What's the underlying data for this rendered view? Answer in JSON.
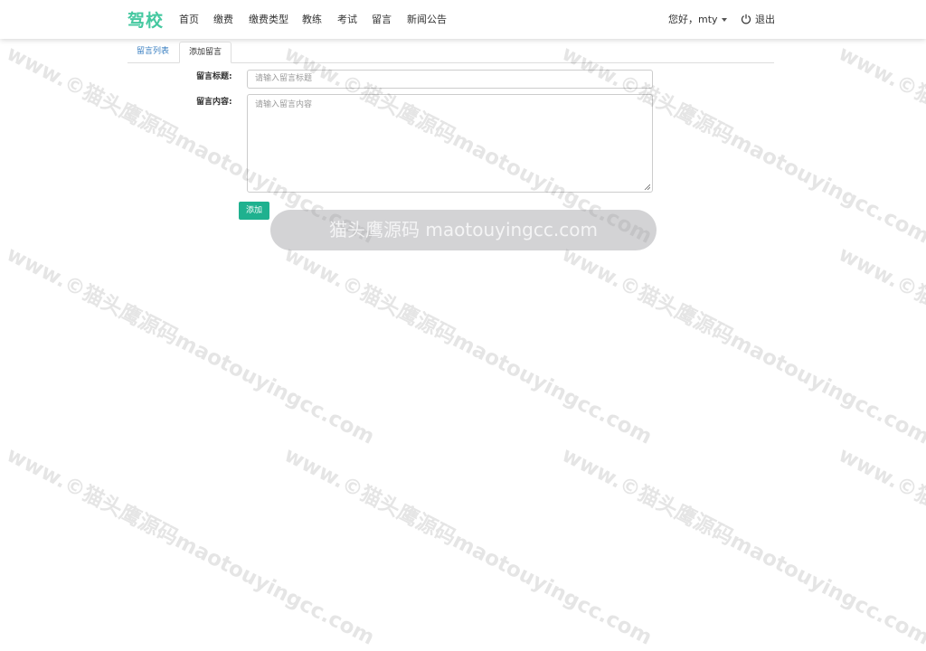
{
  "navbar": {
    "brand": "驾校",
    "items": [
      "首页",
      "缴费",
      "缴费类型",
      "教练",
      "考试",
      "留言",
      "新闻公告"
    ],
    "user_greeting": "您好，mty",
    "logout_label": "退出"
  },
  "tabs": {
    "list_label": "留言列表",
    "add_label": "添加留言"
  },
  "form": {
    "title_label": "留言标题:",
    "title_placeholder": "请输入留言标题",
    "content_label": "留言内容:",
    "content_placeholder": "请输入留言内容",
    "submit_label": "添加"
  },
  "watermark": {
    "text": "www.©猫头鹰源码maotouyingcc.com",
    "banner": "猫头鹰源码 maotouyingcc.com"
  },
  "colors": {
    "brand": "#45c8a0",
    "button": "#1fb18f",
    "tab_link": "#3a7fc1"
  }
}
